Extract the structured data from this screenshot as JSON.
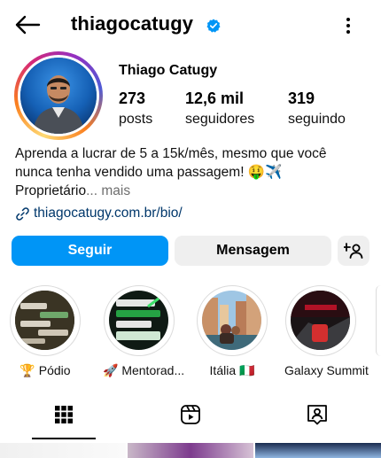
{
  "header": {
    "username": "thiagocatugy",
    "icons": {
      "back": "arrow-left-icon",
      "verified": "verified-badge-icon",
      "menu": "kebab-menu-icon"
    }
  },
  "profile": {
    "full_name": "Thiago Catugy",
    "stats": [
      {
        "value": "273",
        "label": "posts"
      },
      {
        "value": "12,6 mil",
        "label": "seguidores"
      },
      {
        "value": "319",
        "label": "seguindo"
      }
    ],
    "bio": {
      "line1": "Aprenda a lucrar de 5 a 15k/mês, mesmo que você",
      "line2": "nunca tenha vendido uma passagem! 🤑✈️",
      "line3": "Proprietário",
      "ellipsis": "...",
      "more": " mais"
    },
    "link": "thiagocatugy.com.br/bio/"
  },
  "actions": {
    "follow": "Seguir",
    "message": "Mensagem",
    "add_user_icon": "add-person-icon"
  },
  "highlights": [
    {
      "label": "🏆 Pódio"
    },
    {
      "label": "🚀 Mentorad..."
    },
    {
      "label": "Itália 🇮🇹"
    },
    {
      "label": "Galaxy Summit"
    }
  ],
  "tabs": [
    {
      "icon": "grid-icon",
      "active": true
    },
    {
      "icon": "reels-icon",
      "active": false
    },
    {
      "icon": "tagged-icon",
      "active": false
    }
  ],
  "colors": {
    "primary": "#0095f6",
    "link": "#00376b",
    "verified": "#0095f6"
  }
}
